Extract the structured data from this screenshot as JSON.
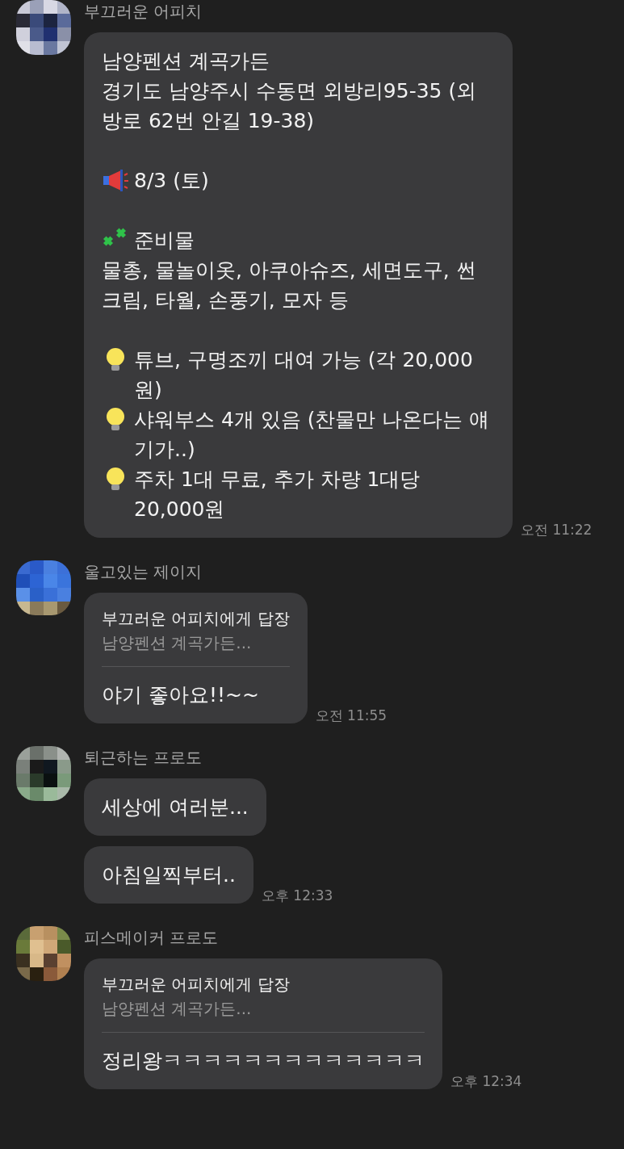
{
  "groups": [
    {
      "sender": "부끄러운 어피치",
      "messages": [
        {
          "kind": "rich",
          "time": "오전 11:22",
          "paragraphs": [
            {
              "lines": [
                {
                  "kind": "plain",
                  "text": "남양펜션 계곡가든"
                },
                {
                  "kind": "plain",
                  "text": "경기도 남양주시 수동면 외방리95-35 (외방로 62번 안길 19-38)"
                }
              ]
            },
            {
              "lines": [
                {
                  "kind": "megaphone",
                  "text": "8/3 (토)"
                }
              ]
            },
            {
              "lines": [
                {
                  "kind": "clover",
                  "text": "준비물"
                },
                {
                  "kind": "plain",
                  "text": "물총, 물놀이옷, 아쿠아슈즈, 세면도구, 썬크림, 타월, 손풍기, 모자 등"
                }
              ]
            },
            {
              "lines": [
                {
                  "kind": "bulb",
                  "text": "튜브, 구명조끼 대여 가능 (각 20,000원)"
                },
                {
                  "kind": "bulb",
                  "text": "샤워부스 4개 있음 (찬물만 나온다는 얘기가..)"
                },
                {
                  "kind": "bulb",
                  "text": "주차 1대 무료, 추가 차량 1대당 20,000원"
                }
              ]
            }
          ]
        }
      ]
    },
    {
      "sender": "울고있는 제이지",
      "messages": [
        {
          "kind": "reply",
          "time": "오전 11:55",
          "reply_to": "부끄러운 어피치에게 답장",
          "quote": "남양펜션 계곡가든...",
          "text": "야기 좋아요!!~~"
        }
      ]
    },
    {
      "sender": "퇴근하는 프로도",
      "messages": [
        {
          "kind": "text",
          "text": "세상에 여러분..."
        },
        {
          "kind": "text",
          "time": "오후 12:33",
          "text": "아침일찍부터.."
        }
      ]
    },
    {
      "sender": "피스메이커 프로도",
      "messages": [
        {
          "kind": "reply",
          "time": "오후 12:34",
          "reply_to": "부끄러운 어피치에게 답장",
          "quote": "남양펜션 계곡가든...",
          "text": "정리왕ㅋㅋㅋㅋㅋㅋㅋㅋㅋㅋㅋㅋㅋ"
        }
      ]
    }
  ]
}
